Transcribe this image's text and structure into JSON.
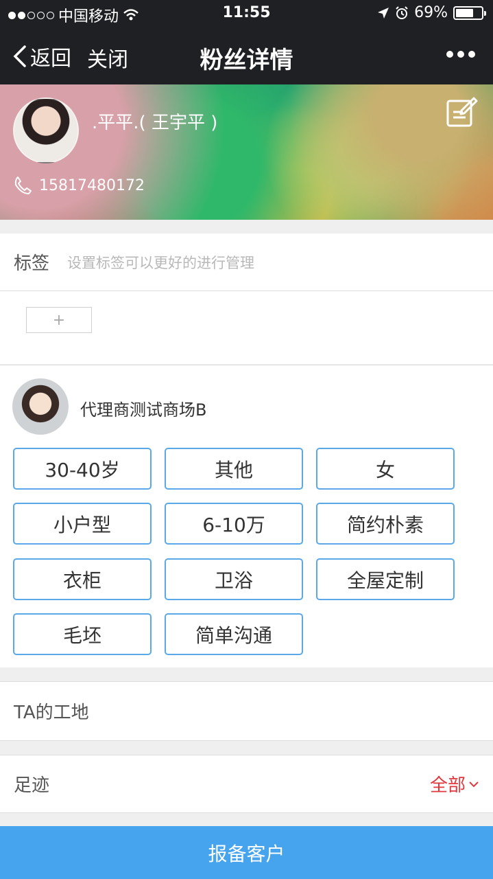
{
  "status_bar": {
    "carrier": "中国移动",
    "time": "11:55",
    "battery": "69%",
    "battery_level": 0.69,
    "signal_bars": 2
  },
  "nav": {
    "back_label": "返回",
    "close_label": "关闭",
    "title": "粉丝详情"
  },
  "profile": {
    "name": ".平平.( 王宇平 )",
    "phone": "15817480172"
  },
  "tags": {
    "label": "标签",
    "hint": "设置标签可以更好的进行管理",
    "add_label": "+"
  },
  "agent": {
    "name": "代理商测试商场B",
    "chips": [
      "30-40岁",
      "其他",
      "女",
      "小户型",
      "6-10万",
      "简约朴素",
      "衣柜",
      "卫浴",
      "全屋定制",
      "毛坯",
      "简单沟通"
    ]
  },
  "site": {
    "label": "TA的工地"
  },
  "footprint": {
    "label": "足迹",
    "filter_label": "全部"
  },
  "bottom_button": {
    "label": "报备客户"
  },
  "colors": {
    "nav_bg": "#1f2024",
    "chip_border": "#5ba8e8",
    "accent_red": "#e0383e",
    "button_blue": "#46a3ee"
  }
}
